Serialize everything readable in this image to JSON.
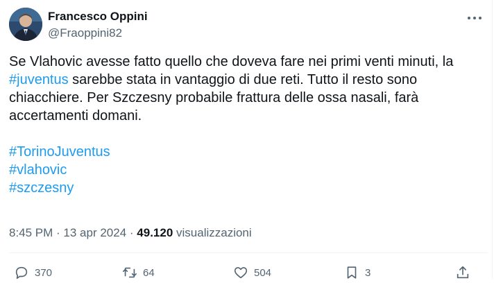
{
  "author": {
    "display_name": "Francesco Oppini",
    "handle": "@Fraoppini82"
  },
  "tweet": {
    "line1_pre": "Se Vlahovic avesse fatto quello che doveva fare nei primi venti minuti, la",
    "hashtag_inline": "#juventus",
    "line1_post": " sarebbe stata in vantaggio di due reti. Tutto il resto sono chiacchiere. Per Szczesny probabile frattura delle ossa nasali, farà accertamenti domani.",
    "hashtags": [
      "#TorinoJuventus",
      "#vlahovic",
      "#szczesny"
    ]
  },
  "meta": {
    "time": "8:45 PM",
    "separator": " · ",
    "date": "13 apr 2024",
    "views_count": "49.120",
    "views_label": " visualizzazioni"
  },
  "actions": {
    "replies": "370",
    "reposts": "64",
    "likes": "504",
    "bookmarks": "3"
  },
  "icons": {
    "more": "more-dots-icon",
    "reply": "reply-icon",
    "repost": "repost-icon",
    "like": "like-icon",
    "bookmark": "bookmark-icon",
    "share": "share-icon"
  }
}
